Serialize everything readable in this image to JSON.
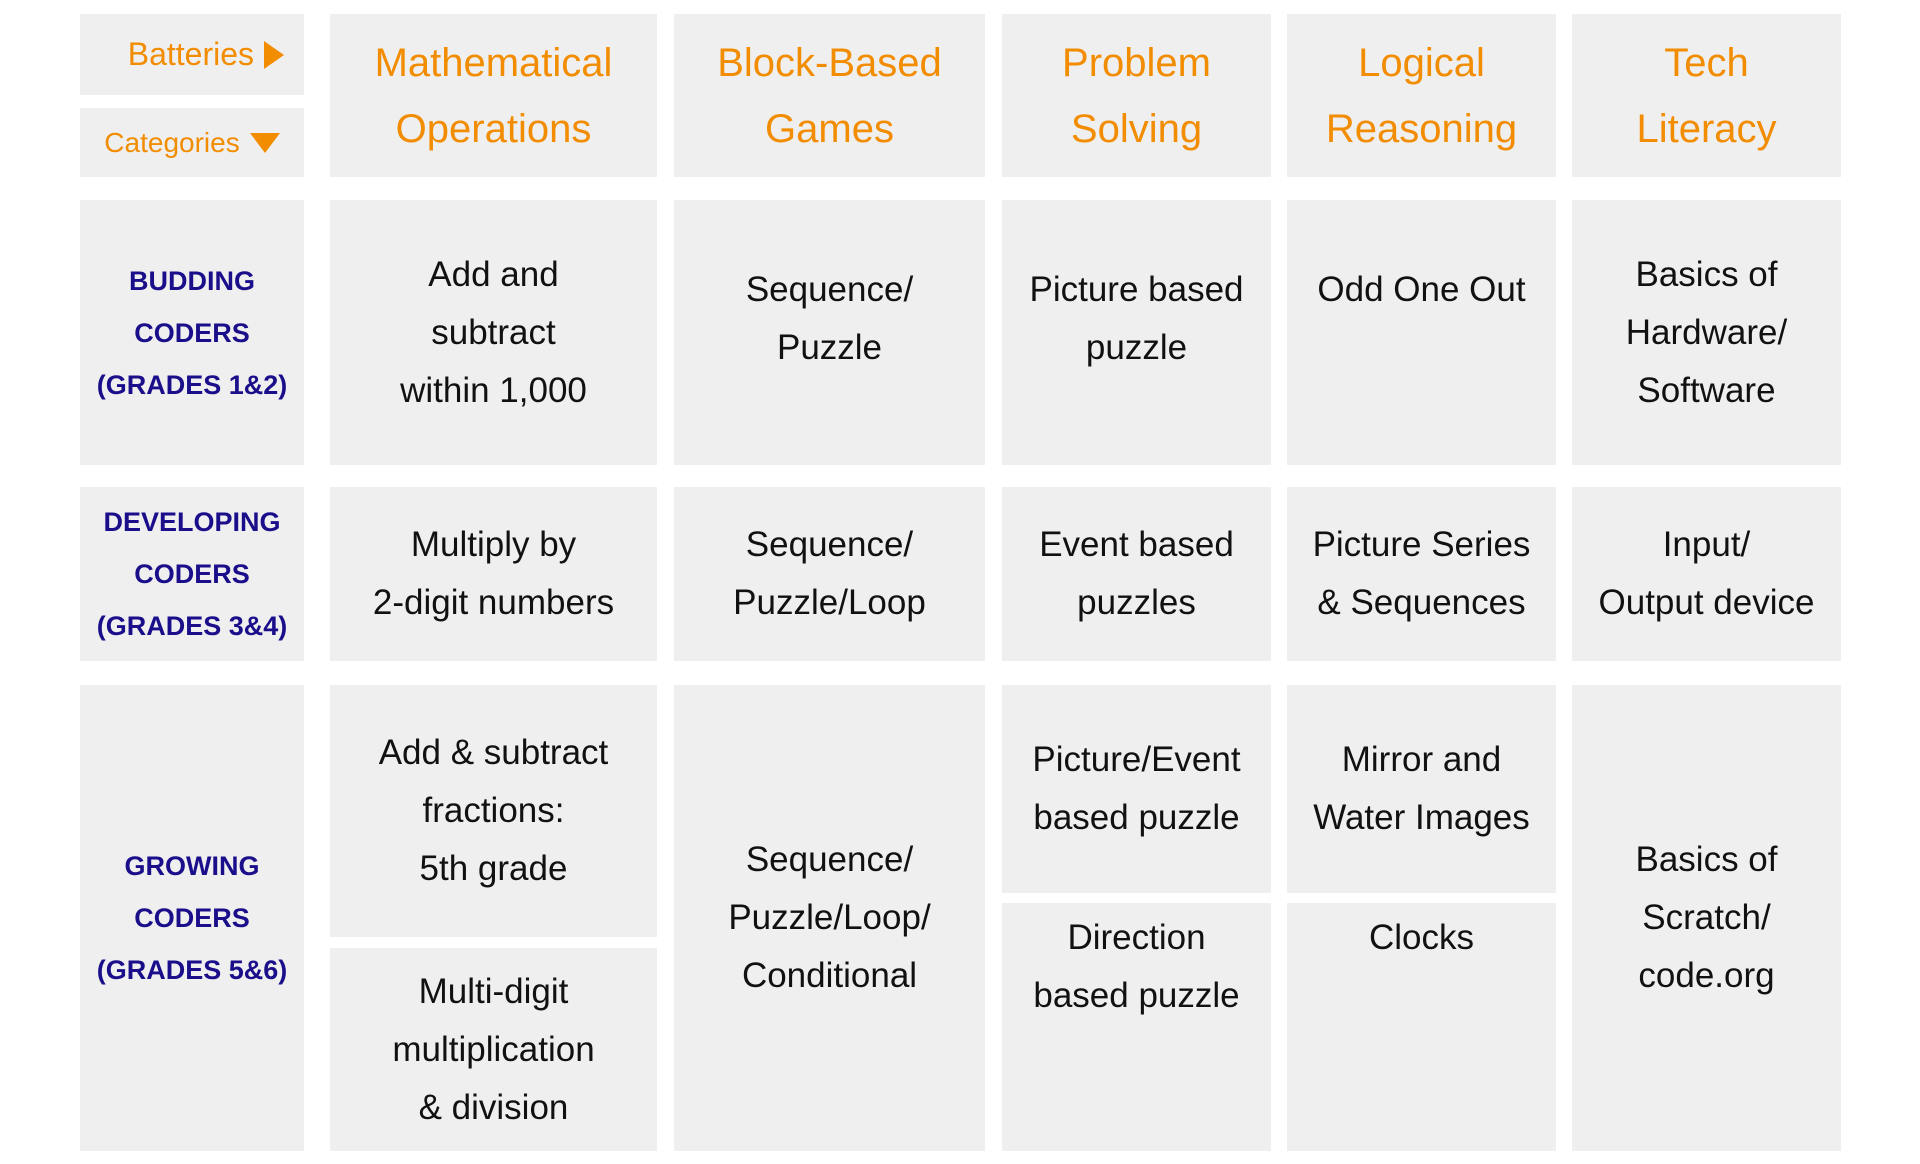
{
  "corner": {
    "batteries_label": "Batteries",
    "batteries_icon": "triangle-right-icon",
    "categories_label": "Categories",
    "categories_icon": "triangle-down-icon"
  },
  "columns": [
    {
      "label": "Mathematical\nOperations"
    },
    {
      "label": "Block-Based\nGames"
    },
    {
      "label": "Problem\nSolving"
    },
    {
      "label": "Logical\nReasoning"
    },
    {
      "label": "Tech\nLiteracy"
    }
  ],
  "rows": [
    {
      "label": "BUDDING\nCODERS\n(GRADES 1&2)",
      "cells": {
        "math": "Add and\nsubtract\nwithin 1,000",
        "block": "Sequence/\nPuzzle",
        "problem": "Picture based\npuzzle",
        "logical": "Odd One Out",
        "tech": "Basics of\nHardware/\nSoftware"
      }
    },
    {
      "label": "DEVELOPING\nCODERS\n(GRADES 3&4)",
      "cells": {
        "math": "Multiply by\n2-digit numbers",
        "block": "Sequence/\nPuzzle/Loop",
        "problem": "Event based\npuzzles",
        "logical": "Picture Series\n& Sequences",
        "tech": "Input/\nOutput device"
      }
    },
    {
      "label": "GROWING\nCODERS\n(GRADES 5&6)",
      "cells": {
        "math_a": "Add & subtract\nfractions:\n5th grade",
        "math_b": "Multi-digit\nmultiplication\n& division",
        "block": "Sequence/\nPuzzle/Loop/\nConditional",
        "problem_a": "Picture/Event\nbased puzzle",
        "problem_b": "Direction\nbased puzzle",
        "logical_a": "Mirror and\nWater Images",
        "logical_b": "Clocks",
        "tech": "Basics of\nScratch/\ncode.org"
      }
    }
  ],
  "colors": {
    "header_accent": "#f28c00",
    "grade_label": "#1a0e8a",
    "cell_background": "#efefef",
    "body_text": "#111111"
  }
}
